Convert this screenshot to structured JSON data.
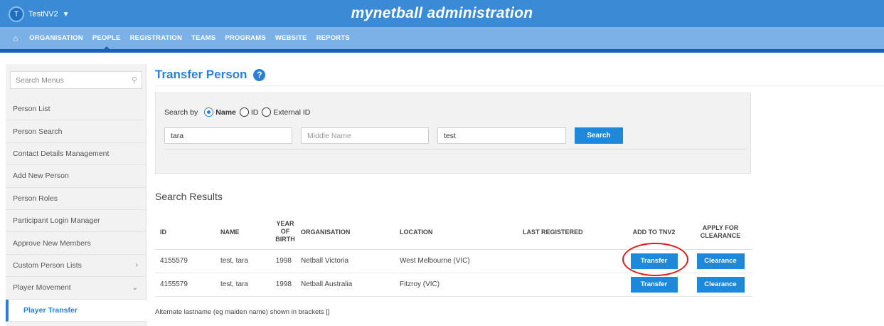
{
  "header": {
    "org_initial": "T",
    "org_name": "TestNV2",
    "app_title": "mynetball administration"
  },
  "nav": {
    "home_icon": "home-icon",
    "items": [
      "ORGANISATION",
      "PEOPLE",
      "REGISTRATION",
      "TEAMS",
      "PROGRAMS",
      "WEBSITE",
      "REPORTS"
    ],
    "active": "PEOPLE"
  },
  "sidebar": {
    "search_placeholder": "Search Menus",
    "items": [
      {
        "label": "Person List"
      },
      {
        "label": "Person Search"
      },
      {
        "label": "Contact Details Management"
      },
      {
        "label": "Add New Person"
      },
      {
        "label": "Person Roles"
      },
      {
        "label": "Participant Login Manager"
      },
      {
        "label": "Approve New Members"
      },
      {
        "label": "Custom Person Lists",
        "chevron": "chevron-right-icon"
      },
      {
        "label": "Player Movement",
        "chevron": "chevron-down-icon"
      },
      {
        "label": "Player Transfer",
        "selected": true
      }
    ]
  },
  "page": {
    "title": "Transfer Person",
    "help_icon": "?"
  },
  "search": {
    "label": "Search by",
    "options": [
      "Name",
      "ID",
      "External ID"
    ],
    "selected": "Name",
    "first_name_value": "tara",
    "middle_name_placeholder": "Middle Name",
    "last_name_value": "test",
    "button": "Search"
  },
  "results": {
    "title": "Search Results",
    "columns": {
      "id": "ID",
      "name": "NAME",
      "year_l1": "YEAR",
      "year_l2": "OF",
      "year_l3": "BIRTH",
      "organisation": "ORGANISATION",
      "location": "LOCATION",
      "last_registered": "LAST REGISTERED",
      "add_to": "ADD TO TNV2",
      "apply_l1": "APPLY FOR",
      "apply_l2": "CLEARANCE"
    },
    "rows": [
      {
        "id": "4155579",
        "name": "test, tara",
        "year": "1998",
        "organisation": "Netball Victoria",
        "location": "West Melbourne (VIC)",
        "last_registered": "",
        "transfer": "Transfer",
        "clearance": "Clearance"
      },
      {
        "id": "4155579",
        "name": "test, tara",
        "year": "1998",
        "organisation": "Netball Australia",
        "location": "Fitzroy (VIC)",
        "last_registered": "",
        "transfer": "Transfer",
        "clearance": "Clearance"
      }
    ],
    "footnote": "Alternate lastname (eg maiden name) shown in brackets []"
  },
  "colors": {
    "topbar": "#3a8ad6",
    "navbar": "#7cb1e8",
    "accent": "#1e88db",
    "highlight_ring": "#e01818"
  }
}
